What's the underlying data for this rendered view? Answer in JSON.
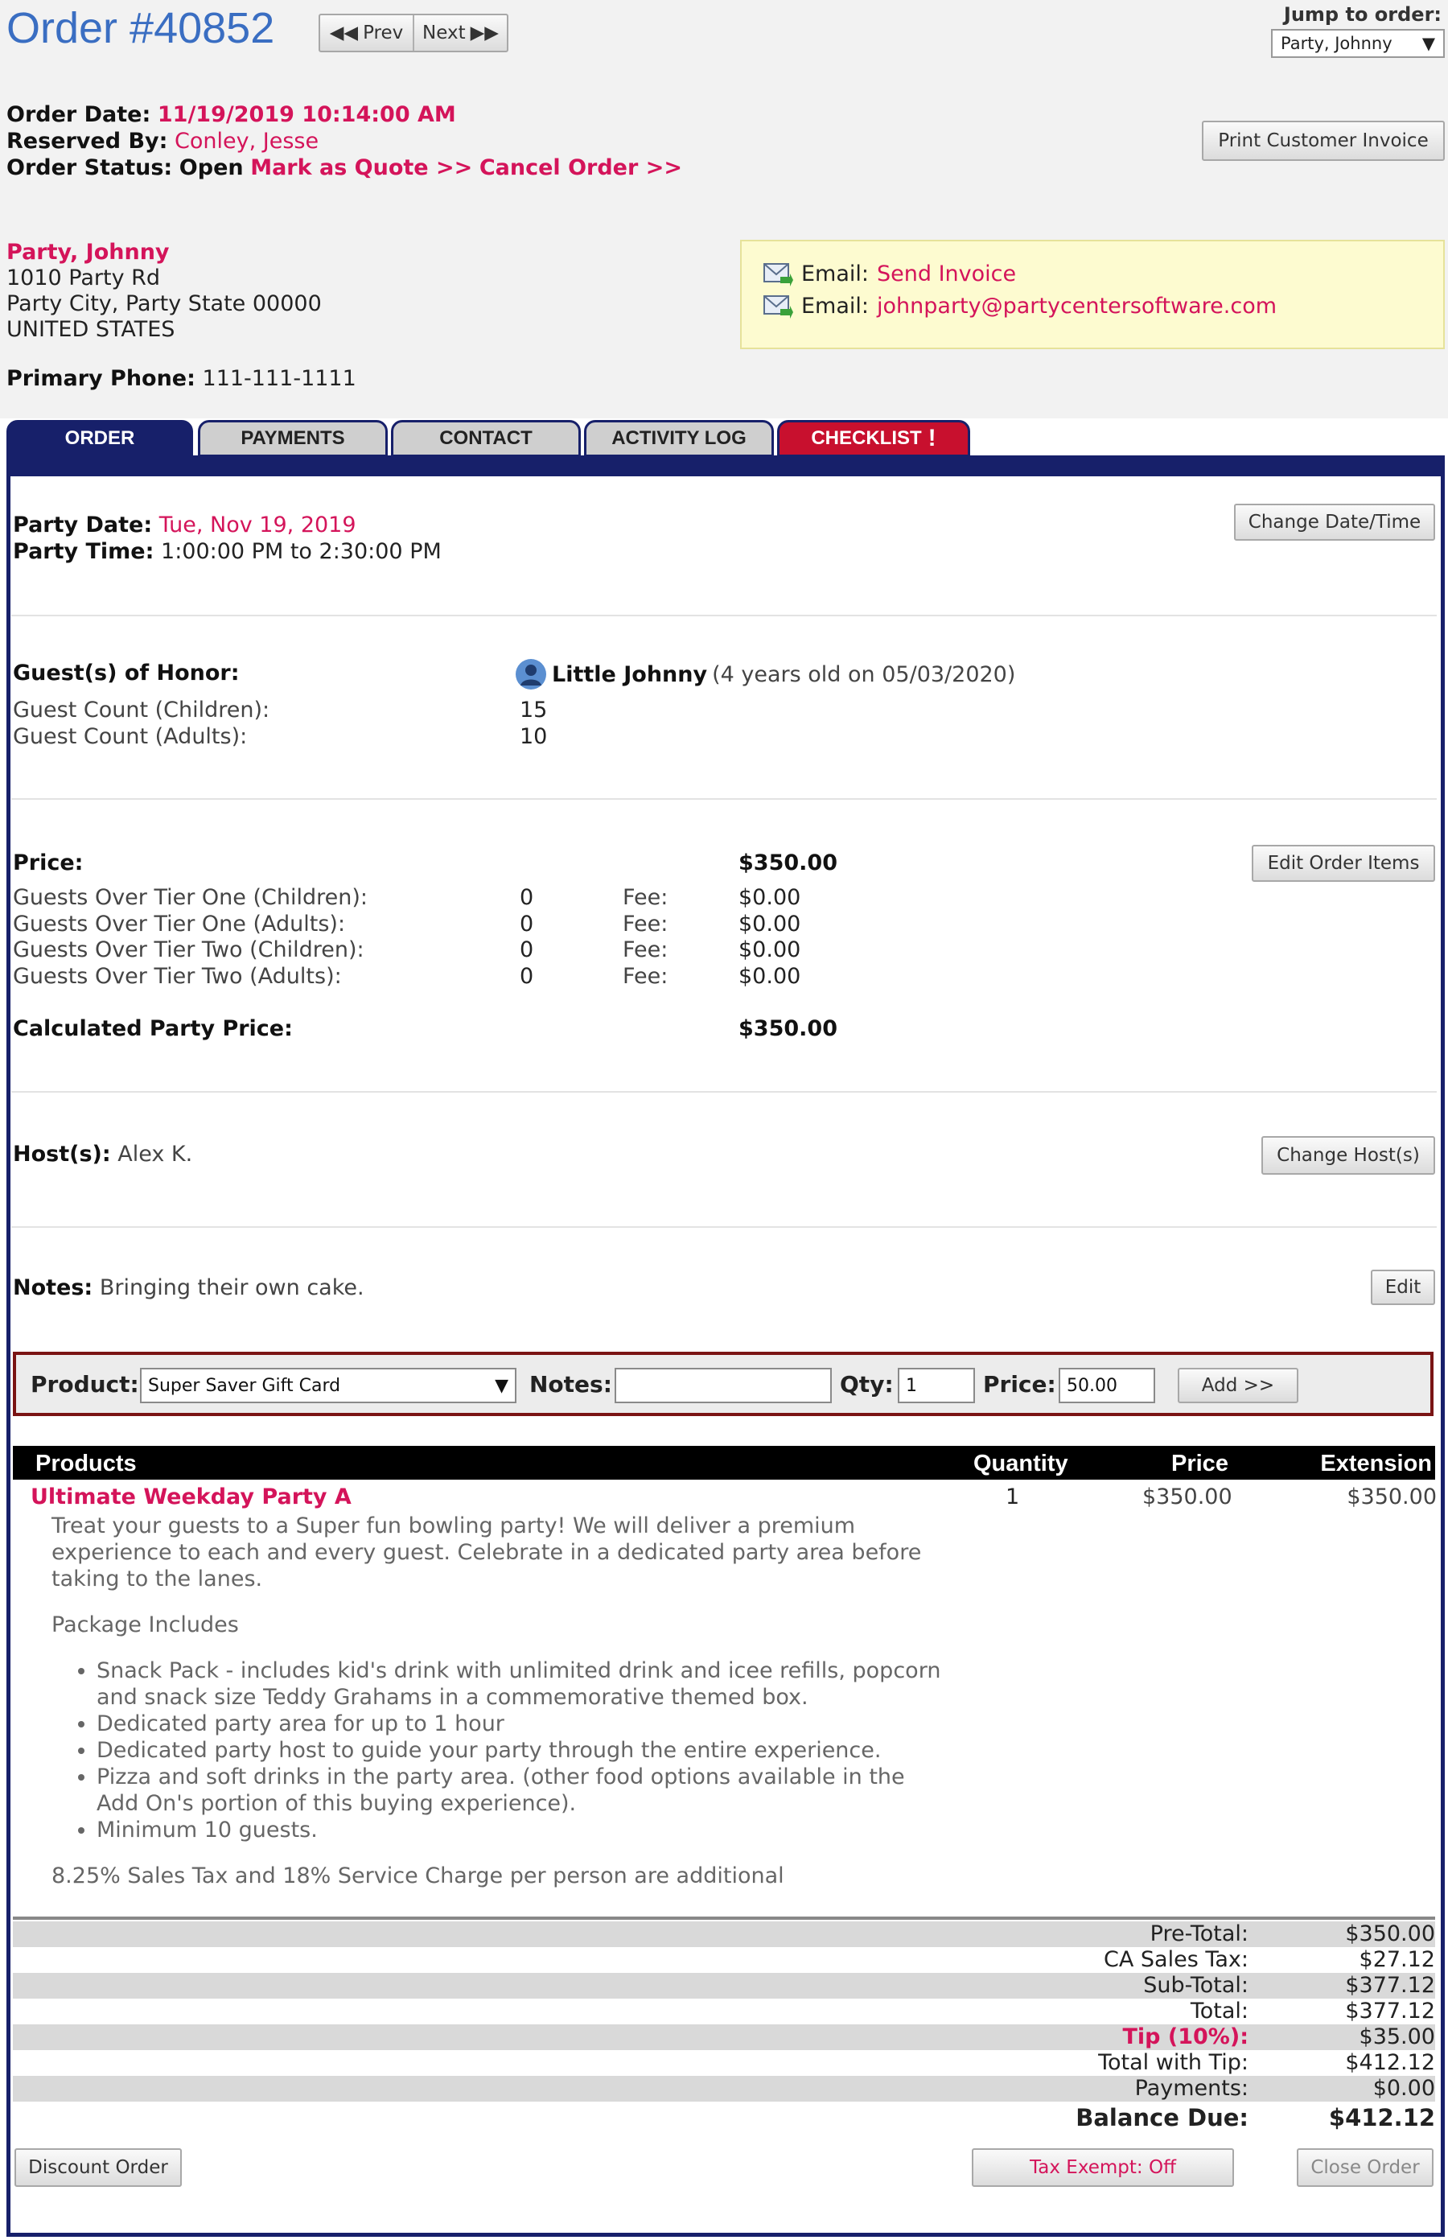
{
  "header": {
    "title": "Order #40852",
    "prev_label": "Prev",
    "next_label": "Next",
    "jump_label": "Jump to order:",
    "jump_value": "Party, Johnny",
    "print_invoice_label": "Print Customer Invoice"
  },
  "order_info": {
    "date_label": "Order Date:",
    "date_value": "11/19/2019 10:14:00 AM",
    "reserved_label": "Reserved By:",
    "reserved_value": "Conley, Jesse",
    "status_label": "Order Status:",
    "status_value": "Open",
    "mark_quote_link": "Mark as Quote >>",
    "cancel_link": "Cancel Order >>"
  },
  "customer": {
    "name": "Party, Johnny",
    "address1": "1010 Party Rd",
    "address2": "Party City, Party State 00000",
    "country": "UNITED STATES",
    "phone_label": "Primary Phone:",
    "phone_value": "111-111-1111"
  },
  "email_box": {
    "label1": "Email:",
    "link1": "Send Invoice",
    "label2": "Email:",
    "link2": "johnparty@partycentersoftware.com"
  },
  "tabs": [
    {
      "label": "ORDER",
      "state": "active"
    },
    {
      "label": "PAYMENTS",
      "state": "inactive"
    },
    {
      "label": "CONTACT",
      "state": "inactive"
    },
    {
      "label": "ACTIVITY LOG",
      "state": "inactive"
    },
    {
      "label": "CHECKLIST",
      "state": "alert",
      "badge": "!"
    }
  ],
  "party": {
    "date_label": "Party Date:",
    "date_value": "Tue, Nov 19, 2019",
    "time_label": "Party Time:",
    "time_value": "1:00:00 PM to 2:30:00 PM",
    "change_datetime_label": "Change Date/Time"
  },
  "guests": {
    "honor_label": "Guest(s) of Honor:",
    "honor_name": "Little Johnny",
    "honor_detail": "(4 years old on 05/03/2020)",
    "children_label": "Guest Count (Children):",
    "children_value": "15",
    "adults_label": "Guest Count (Adults):",
    "adults_value": "10"
  },
  "pricing": {
    "price_label": "Price:",
    "price_value": "$350.00",
    "edit_items_label": "Edit Order Items",
    "fee_label": "Fee:",
    "tiers": [
      {
        "label": "Guests Over Tier One (Children):",
        "count": "0",
        "fee": "$0.00"
      },
      {
        "label": "Guests Over Tier One (Adults):",
        "count": "0",
        "fee": "$0.00"
      },
      {
        "label": "Guests Over Tier Two (Children):",
        "count": "0",
        "fee": "$0.00"
      },
      {
        "label": "Guests Over Tier Two (Adults):",
        "count": "0",
        "fee": "$0.00"
      }
    ],
    "calc_label": "Calculated Party Price:",
    "calc_value": "$350.00"
  },
  "hosts": {
    "label": "Host(s):",
    "value": "Alex K.",
    "change_label": "Change Host(s)"
  },
  "notes": {
    "label": "Notes:",
    "value": "Bringing their own cake.",
    "edit_label": "Edit"
  },
  "add_product": {
    "product_label": "Product:",
    "product_value": "Super Saver Gift Card",
    "notes_label": "Notes:",
    "notes_value": "",
    "qty_label": "Qty:",
    "qty_value": "1",
    "price_label": "Price:",
    "price_value": "50.00",
    "add_label": "Add >>"
  },
  "products_table": {
    "headers": [
      "Products",
      "Quantity",
      "Price",
      "Extension"
    ],
    "item_name": "Ultimate Weekday Party A",
    "item_qty": "1",
    "item_price": "$350.00",
    "item_ext": "$350.00",
    "desc_intro": "Treat your guests to a Super fun bowling party! We will deliver a premium experience to each and every guest.  Celebrate in a dedicated party area before taking to the lanes.",
    "package_heading": "Package Includes",
    "bullets": [
      "Snack Pack - includes kid's drink with unlimited drink and icee refills, popcorn and snack size Teddy Grahams in a commemorative themed box.",
      "Dedicated party area for up to 1 hour",
      "Dedicated party host to guide your party through the entire experience.",
      "Pizza and soft drinks in the party area.  (other food options available in the Add On's portion of this buying experience).",
      "Minimum 10 guests."
    ],
    "tax_note": "8.25% Sales Tax and 18% Service Charge per person are additional"
  },
  "totals": [
    {
      "label": "Pre-Total:",
      "value": "$350.00"
    },
    {
      "label": "CA Sales Tax:",
      "value": "$27.12"
    },
    {
      "label": "Sub-Total:",
      "value": "$377.12"
    },
    {
      "label": "Total:",
      "value": "$377.12"
    },
    {
      "label": "Tip (10%):",
      "value": "$35.00"
    },
    {
      "label": "Total with Tip:",
      "value": "$412.12"
    },
    {
      "label": "Payments:",
      "value": "$0.00"
    },
    {
      "label": "Balance Due:",
      "value": "$412.12"
    }
  ],
  "footer": {
    "discount_label": "Discount Order",
    "tax_exempt_label": "Tax Exempt: Off",
    "close_label": "Close Order"
  },
  "colors": {
    "title_blue": "#3a6ec2",
    "link_pink": "#d4145a",
    "tab_navy": "#17206a",
    "tab_alert_red": "#c8102e",
    "email_box_bg": "#fdfbd0"
  }
}
